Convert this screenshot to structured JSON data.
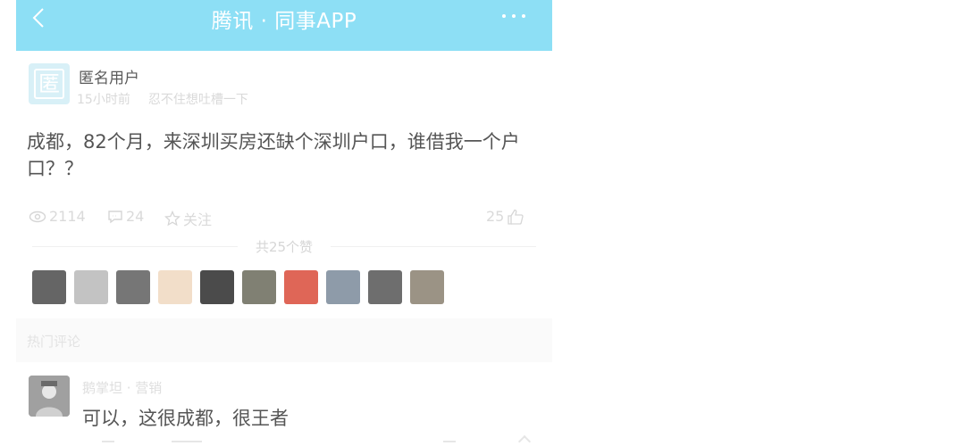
{
  "navbar": {
    "title": "腾讯 · 同事APP",
    "back_icon": "chevron-left-icon",
    "more_icon": "more-dots-icon",
    "background": "#8ddff5"
  },
  "post": {
    "avatar_char": "匿",
    "author": "匿名用户",
    "time": "15小时前",
    "tag": "忍不住想吐槽一下",
    "body": "成都，82个月，来深圳买房还缺个深圳户口，谁借我一个户口？？",
    "views": "2114",
    "comments": "24",
    "follow_label": "关注",
    "likes": "25"
  },
  "likes_section": {
    "label": "共25个赞",
    "avatars": [
      {
        "name": "liker-avatar-1",
        "color": "#4a4a4a"
      },
      {
        "name": "liker-avatar-2",
        "color": "#b8b8b8"
      },
      {
        "name": "liker-avatar-3",
        "color": "#5e5e5e"
      },
      {
        "name": "liker-avatar-4",
        "color": "#f0d8c0"
      },
      {
        "name": "liker-avatar-5",
        "color": "#2b2b2b"
      },
      {
        "name": "liker-avatar-6",
        "color": "#6a6a5a"
      },
      {
        "name": "liker-avatar-7",
        "color": "#d94b3a"
      },
      {
        "name": "liker-avatar-8",
        "color": "#7a8a9a"
      },
      {
        "name": "liker-avatar-9",
        "color": "#555555"
      },
      {
        "name": "liker-avatar-10",
        "color": "#8a8070"
      }
    ]
  },
  "hot_comments": {
    "title": "热门评论",
    "items": [
      {
        "author": "鹅掌坦 · 营销",
        "text": "可以，这很成都，很王者"
      }
    ]
  }
}
